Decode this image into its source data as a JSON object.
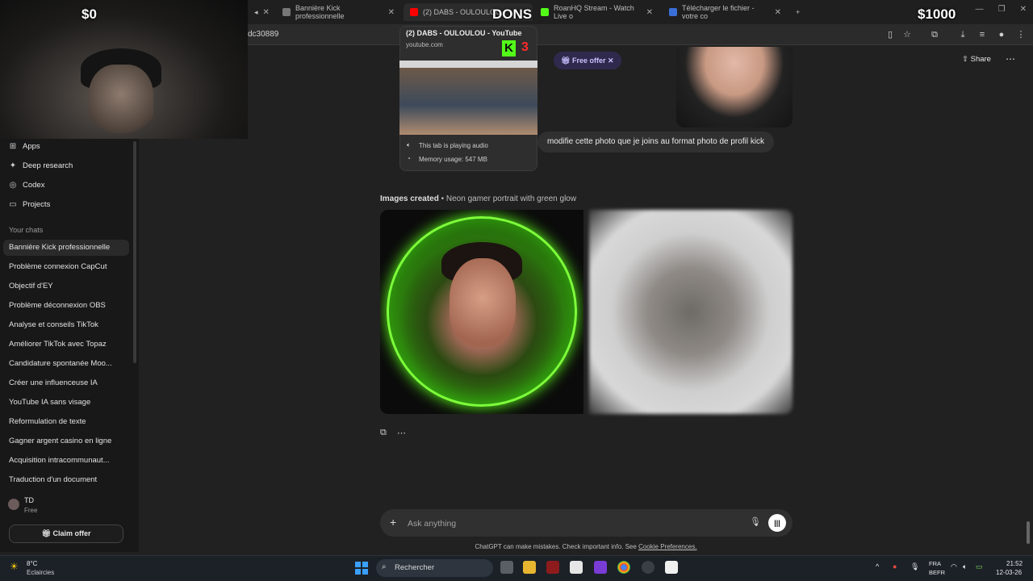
{
  "browser": {
    "tabs": [
      {
        "title": "Bannière Kick professionnelle"
      },
      {
        "title": "(2) DABS - OULOULOU"
      },
      {
        "title": "RoanHQ Stream - Watch Live o"
      },
      {
        "title": "Télécharger le fichier - votre co"
      }
    ],
    "address_fragment": "dc30889"
  },
  "overlay": {
    "donation_left": "$0",
    "donation_label": "DONS",
    "donation_right": "$1000",
    "kick_logo": "K",
    "kick_count": "3"
  },
  "hovercard": {
    "title": "(2) DABS - OULOULOU - YouTube",
    "url": "youtube.com",
    "audio": "This tab is playing audio",
    "memory": "Memory usage: 547 MB"
  },
  "sidebar": {
    "nav": [
      {
        "label": "Apps",
        "icon": "apps-icon"
      },
      {
        "label": "Deep research",
        "icon": "telescope-icon"
      },
      {
        "label": "Codex",
        "icon": "codex-icon"
      },
      {
        "label": "Projects",
        "icon": "folder-icon"
      }
    ],
    "section_title": "Your chats",
    "chats": [
      "Bannière Kick professionnelle",
      "Problème connexion CapCut",
      "Objectif d'EY",
      "Problème déconnexion OBS",
      "Analyse et conseils TikTok",
      "Améliorer TikTok avec Topaz",
      "Candidature spontanée Moo...",
      "Créer une influenceuse IA",
      "YouTube IA sans visage",
      "Reformulation de texte",
      "Gagner argent casino en ligne",
      "Acquisition intracommunaut...",
      "Traduction d'un document"
    ],
    "user": {
      "name": "TD",
      "plan": "Free"
    },
    "claim_offer": "Claim offer"
  },
  "main": {
    "free_offer": "Free offer",
    "share": "Share",
    "user_message": "modifie cette photo que je joins au format photo de profil kick",
    "images_created_label": "Images created",
    "images_created_title": "• Neon gamer portrait with green glow",
    "composer_placeholder": "Ask anything",
    "disclaimer_text": "ChatGPT can make mistakes. Check important info. See",
    "disclaimer_link": "Cookie Preferences."
  },
  "taskbar": {
    "weather_temp": "8°C",
    "weather_desc": "Eclaircies",
    "search": "Rechercher",
    "lang1": "FRA",
    "lang2": "BEFR",
    "time": "21:52",
    "date": "12-03-26"
  },
  "colors": {
    "accent_green": "#53fc18",
    "neon_green": "#7dff3a",
    "free_offer_bg": "#2f2a4d"
  }
}
